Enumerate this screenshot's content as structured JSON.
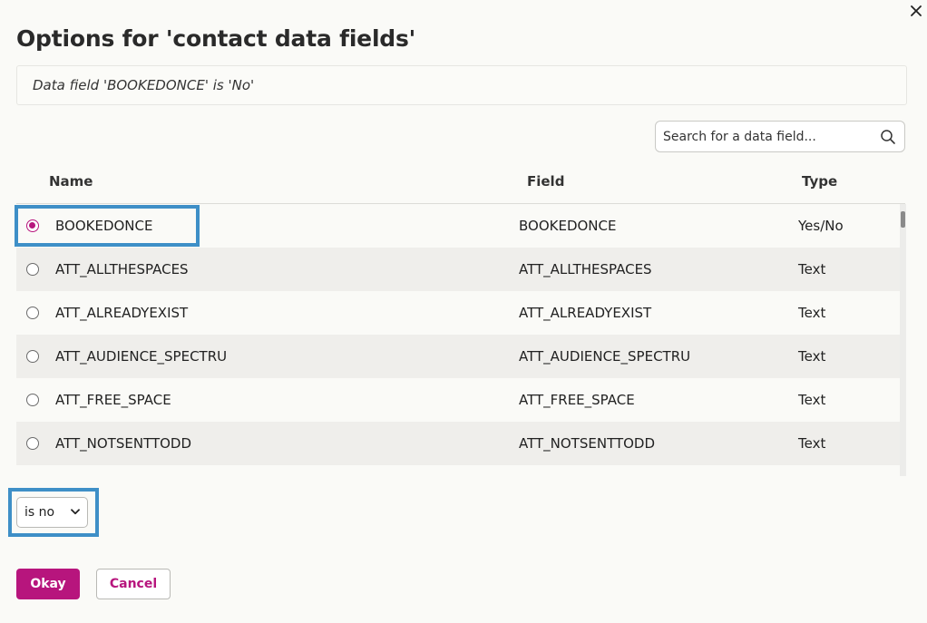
{
  "dialog": {
    "title": "Options for 'contact data fields'",
    "condition_text": "Data field 'BOOKEDONCE' is 'No'",
    "close_icon": "close-icon"
  },
  "search": {
    "placeholder": "Search for a data field...",
    "value": "",
    "icon": "search-icon"
  },
  "table": {
    "columns": {
      "name": "Name",
      "field": "Field",
      "type": "Type"
    },
    "rows": [
      {
        "name": "BOOKEDONCE",
        "field": "BOOKEDONCE",
        "type": "Yes/No",
        "selected": true
      },
      {
        "name": "ATT_ALLTHESPACES",
        "field": "ATT_ALLTHESPACES",
        "type": "Text",
        "selected": false
      },
      {
        "name": "ATT_ALREADYEXIST",
        "field": "ATT_ALREADYEXIST",
        "type": "Text",
        "selected": false
      },
      {
        "name": "ATT_AUDIENCE_SPECTRU",
        "field": "ATT_AUDIENCE_SPECTRU",
        "type": "Text",
        "selected": false
      },
      {
        "name": "ATT_FREE_SPACE",
        "field": "ATT_FREE_SPACE",
        "type": "Text",
        "selected": false
      },
      {
        "name": "ATT_NOTSENTTODD",
        "field": "ATT_NOTSENTTODD",
        "type": "Text",
        "selected": false
      }
    ]
  },
  "operator": {
    "selected": "is no",
    "icon": "chevron-down-icon"
  },
  "footer": {
    "okay_label": "Okay",
    "cancel_label": "Cancel"
  },
  "colors": {
    "accent": "#b7157d",
    "highlight": "#3e8fc7",
    "row_alt": "#efeeeb",
    "background": "#fafaf7"
  }
}
